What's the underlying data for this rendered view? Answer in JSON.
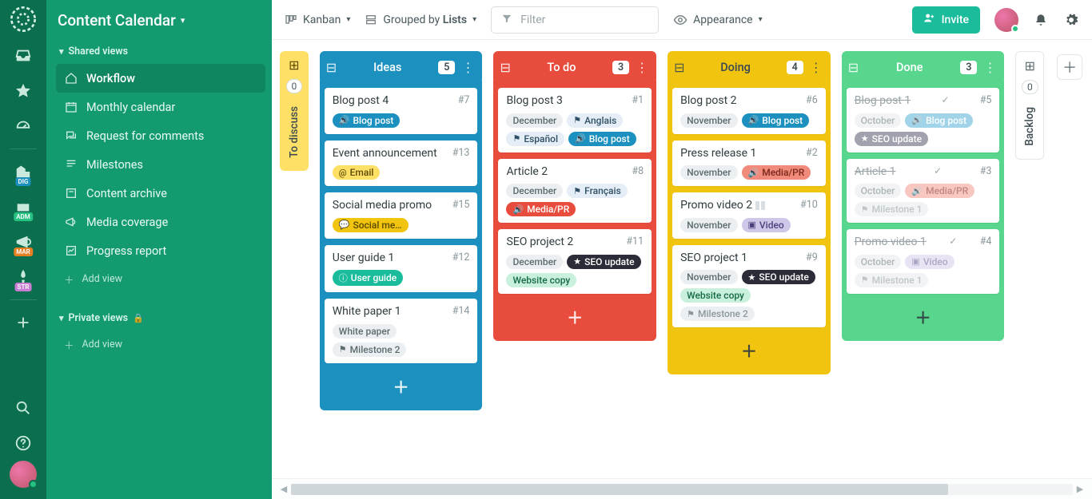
{
  "app_title": "Content Calendar",
  "sidebar": {
    "shared_header": "Shared views",
    "private_header": "Private views",
    "items": [
      {
        "label": "Workflow",
        "icon": "home"
      },
      {
        "label": "Monthly calendar",
        "icon": "calendar"
      },
      {
        "label": "Request for comments",
        "icon": "comments"
      },
      {
        "label": "Milestones",
        "icon": "milestones"
      },
      {
        "label": "Content archive",
        "icon": "archive"
      },
      {
        "label": "Media coverage",
        "icon": "megaphone"
      },
      {
        "label": "Progress report",
        "icon": "progress"
      }
    ],
    "add_view": "Add view"
  },
  "rail_badges": [
    "DIG",
    "ADM",
    "MAR",
    "STR"
  ],
  "topbar": {
    "view": "Kanban",
    "grouped_prefix": "Grouped by ",
    "grouped_value": "Lists",
    "filter_placeholder": "Filter",
    "appearance": "Appearance",
    "invite": "Invite"
  },
  "columns": [
    {
      "type": "collapsed",
      "title": "To discuss",
      "count": "0",
      "color": "yellow"
    },
    {
      "type": "normal",
      "title": "Ideas",
      "count": "5",
      "header_color": "blue",
      "body_color": "blue-body",
      "cards": [
        {
          "title": "Blog post 4",
          "id": "#7",
          "tags": [
            {
              "text": "Blog post",
              "style": "bg:#1c91c0;fg:#fff;icon:bullhorn"
            }
          ]
        },
        {
          "title": "Event announcement",
          "id": "#13",
          "tags": [
            {
              "text": "Email",
              "style": "bg:#ffe066;fg:#5b4a00;icon:at"
            }
          ]
        },
        {
          "title": "Social media promo",
          "id": "#15",
          "tags": [
            {
              "text": "Social me…",
              "style": "bg:#f1c40f;fg:#5b4a00;icon:comment"
            }
          ]
        },
        {
          "title": "User guide 1",
          "id": "#12",
          "tags": [
            {
              "text": "User guide",
              "style": "bg:#1abc9c;fg:#fff;icon:info"
            }
          ]
        },
        {
          "title": "White paper 1",
          "id": "#14",
          "tags": [
            {
              "text": "White paper",
              "style": "bg:#eceff1;fg:#5b6b70"
            },
            {
              "text": "Milestone 2",
              "style": "bg:#eceff1;fg:#5b6b70;icon:flag"
            }
          ]
        }
      ]
    },
    {
      "type": "normal",
      "title": "To do",
      "count": "3",
      "header_color": "red",
      "body_color": "red-body",
      "cards": [
        {
          "title": "Blog post 3",
          "id": "#1",
          "tags": [
            {
              "text": "December",
              "style": "bg:#eceff1;fg:#5b6b70"
            },
            {
              "text": "Anglais",
              "style": "bg:#e5eef6;fg:#2f4f66;icon:flag"
            },
            {
              "text": "Español",
              "style": "bg:#e5eef6;fg:#2f4f66;icon:flag"
            },
            {
              "text": "Blog post",
              "style": "bg:#1c91c0;fg:#fff;icon:bullhorn"
            }
          ]
        },
        {
          "title": "Article 2",
          "id": "#8",
          "tags": [
            {
              "text": "December",
              "style": "bg:#eceff1;fg:#5b6b70"
            },
            {
              "text": "Français",
              "style": "bg:#e5eef6;fg:#2f4f66;icon:flag"
            },
            {
              "text": "Media/PR",
              "style": "bg:#e74c3c;fg:#fff;icon:bullhorn"
            }
          ]
        },
        {
          "title": "SEO project 2",
          "id": "#11",
          "tags": [
            {
              "text": "December",
              "style": "bg:#eceff1;fg:#5b6b70"
            },
            {
              "text": "SEO update",
              "style": "bg:#2c2c38;fg:#fff;icon:star"
            },
            {
              "text": "Website copy",
              "style": "bg:#c8f0dc;fg:#166a45"
            }
          ]
        }
      ]
    },
    {
      "type": "normal",
      "title": "Doing",
      "count": "4",
      "header_color": "amber",
      "body_color": "amber-body",
      "dark_add": true,
      "cards": [
        {
          "title": "Blog post 2",
          "id": "#6",
          "tags": [
            {
              "text": "November",
              "style": "bg:#eceff1;fg:#5b6b70"
            },
            {
              "text": "Blog post",
              "style": "bg:#1c91c0;fg:#fff;icon:bullhorn"
            }
          ]
        },
        {
          "title": "Press release 1",
          "id": "#2",
          "tags": [
            {
              "text": "November",
              "style": "bg:#eceff1;fg:#5b6b70"
            },
            {
              "text": "Media/PR",
              "style": "bg:#f08a7a;fg:#7a261a;icon:bullhorn"
            }
          ]
        },
        {
          "title": "Promo video 2",
          "id": "#10",
          "progress": true,
          "tags": [
            {
              "text": "November",
              "style": "bg:#eceff1;fg:#5b6b70"
            },
            {
              "text": "Video",
              "style": "bg:#cfc7e8;fg:#4b3f7c;icon:video"
            }
          ]
        },
        {
          "title": "SEO project 1",
          "id": "#9",
          "tags": [
            {
              "text": "November",
              "style": "bg:#eceff1;fg:#5b6b70"
            },
            {
              "text": "SEO update",
              "style": "bg:#2c2c38;fg:#fff;icon:star"
            },
            {
              "text": "Website copy",
              "style": "bg:#c8f0dc;fg:#166a45"
            },
            {
              "text": "Milestone 2",
              "style": "bg:#eceff1;fg:#8a979c;icon:flag"
            }
          ]
        }
      ]
    },
    {
      "type": "normal",
      "title": "Done",
      "count": "3",
      "header_color": "green",
      "body_color": "green-body",
      "dark_add": true,
      "cards": [
        {
          "title": "Blog post 1",
          "id": "#5",
          "done": true,
          "tags": [
            {
              "text": "October",
              "style": "bg:#eceff1;fg:#8a979c"
            },
            {
              "text": "Blog post",
              "style": "bg:#7cc3e0;fg:#fff;icon:bullhorn"
            },
            {
              "text": "SEO update",
              "style": "bg:#7b7b8c;fg:#fff;icon:star"
            }
          ]
        },
        {
          "title": "Article 1",
          "id": "#3",
          "done": true,
          "tags": [
            {
              "text": "October",
              "style": "bg:#eceff1;fg:#8a979c"
            },
            {
              "text": "Media/PR",
              "style": "bg:#f5b0a6;fg:#a65347;icon:bullhorn"
            },
            {
              "text": "Milestone 1",
              "style": "bg:#eceff1;fg:#a5b0b4;icon:flag"
            }
          ]
        },
        {
          "title": "Promo video 1",
          "id": "#4",
          "done": true,
          "tags": [
            {
              "text": "October",
              "style": "bg:#eceff1;fg:#8a979c"
            },
            {
              "text": "Video",
              "style": "bg:#e0daef;fg:#8a82ad;icon:video"
            },
            {
              "text": "Milestone 1",
              "style": "bg:#eceff1;fg:#a5b0b4;icon:flag"
            }
          ]
        }
      ]
    },
    {
      "type": "collapsed",
      "title": "Backlog",
      "count": "0",
      "color": "backlog"
    }
  ]
}
